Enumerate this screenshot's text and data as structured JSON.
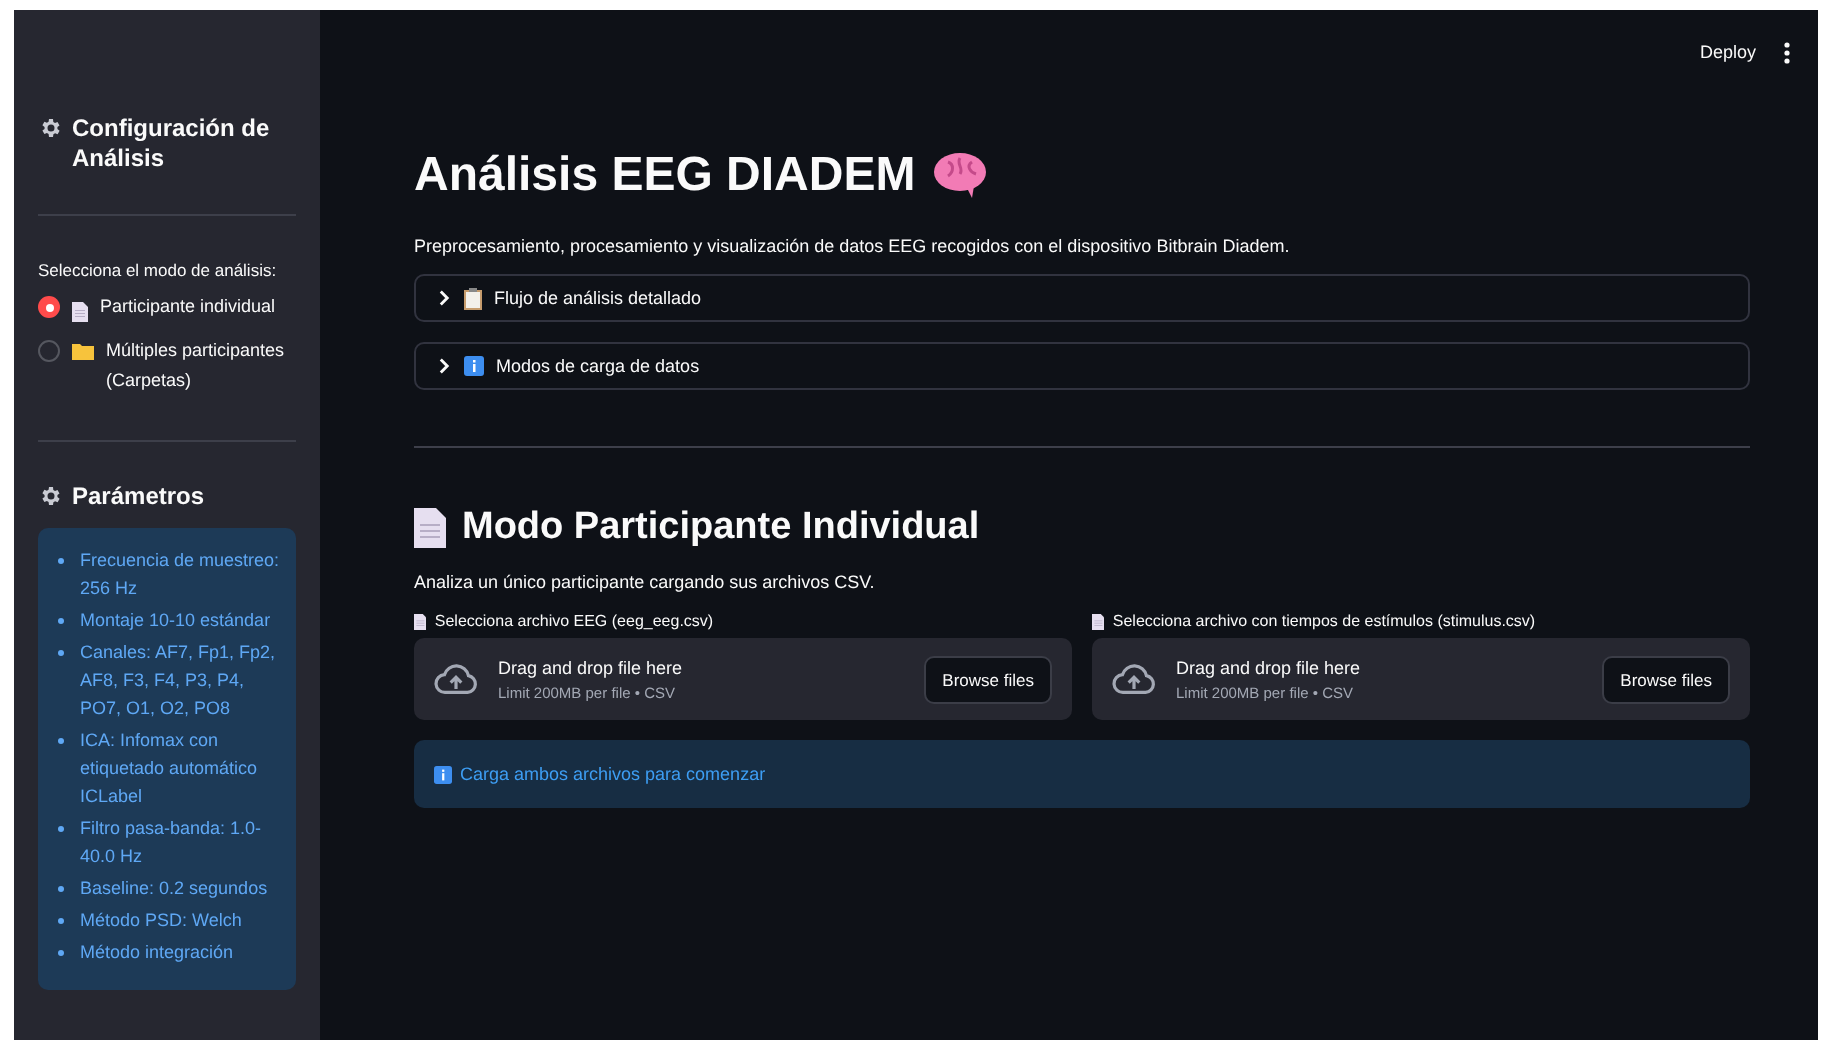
{
  "header": {
    "deploy": "Deploy"
  },
  "sidebar": {
    "title": "Configuración de Análisis",
    "mode": {
      "label": "Selecciona el modo de análisis:",
      "options": [
        {
          "label": "Participante individual",
          "kind": "document",
          "selected": true
        },
        {
          "label": "Múltiples participantes (Carpetas)",
          "kind": "folder",
          "selected": false
        }
      ]
    },
    "parameters": {
      "title": "Parámetros",
      "items": [
        "Frecuencia de muestreo: 256 Hz",
        "Montaje 10-10 estándar",
        "Canales: AF7, Fp1, Fp2, AF8, F3, F4, P3, P4, PO7, O1, O2, PO8",
        "ICA: Infomax con etiquetado automático ICLabel",
        "Filtro pasa-banda: 1.0-40.0 Hz",
        "Baseline: 0.2 segundos",
        "Método PSD: Welch",
        "Método integración"
      ]
    }
  },
  "main": {
    "title": "Análisis EEG DIADEM",
    "subtitle": "Preprocesamiento, procesamiento y visualización de datos EEG recogidos con el dispositivo Bitbrain Diadem.",
    "expanders": [
      {
        "label": "Flujo de análisis detallado",
        "kind": "clipboard",
        "expanded": false
      },
      {
        "label": "Modos de carga de datos",
        "kind": "info",
        "expanded": false
      }
    ],
    "section": {
      "title": "Modo Participante Individual",
      "description": "Analiza un único participante cargando sus archivos CSV.",
      "uploaders": [
        {
          "label": "Selecciona archivo EEG (eeg_eeg.csv)",
          "prompt": "Drag and drop file here",
          "limit": "Limit 200MB per file • CSV",
          "button": "Browse files"
        },
        {
          "label": "Selecciona archivo con tiempos de estímulos (stimulus.csv)",
          "prompt": "Drag and drop file here",
          "limit": "Limit 200MB per file • CSV",
          "button": "Browse files"
        }
      ],
      "info": "Carga ambos archivos para comenzar"
    }
  }
}
